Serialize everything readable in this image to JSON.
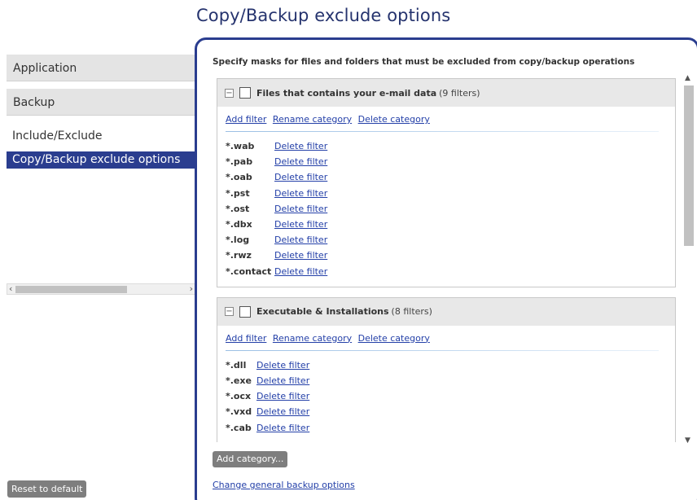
{
  "page_title": "Copy/Backup exclude options",
  "nav": {
    "groups": [
      "Application",
      "Backup"
    ],
    "subitems": [
      "Include/Exclude",
      "Copy/Backup exclude options"
    ],
    "active": "Copy/Backup exclude options"
  },
  "reset_label": "Reset to default",
  "instruction": "Specify masks for files and folders that must be excluded from copy/backup operations",
  "actions": {
    "add_filter": "Add filter",
    "rename_category": "Rename category",
    "delete_category": "Delete category",
    "delete_filter": "Delete filter"
  },
  "categories": [
    {
      "name": "Files that contains your e-mail data",
      "count": "(9 filters)",
      "filters": [
        "*.wab",
        "*.pab",
        "*.oab",
        "*.pst",
        "*.ost",
        "*.dbx",
        "*.log",
        "*.rwz",
        "*.contact"
      ]
    },
    {
      "name": "Executable & Installations",
      "count": "(8 filters)",
      "filters": [
        "*.dll",
        "*.exe",
        "*.ocx",
        "*.vxd",
        "*.cab"
      ]
    }
  ],
  "add_category_label": "Add category...",
  "general_link": "Change general backup options",
  "colors": {
    "accent": "#2a3d8f",
    "link": "#2440a8",
    "button": "#7e7e7e"
  }
}
